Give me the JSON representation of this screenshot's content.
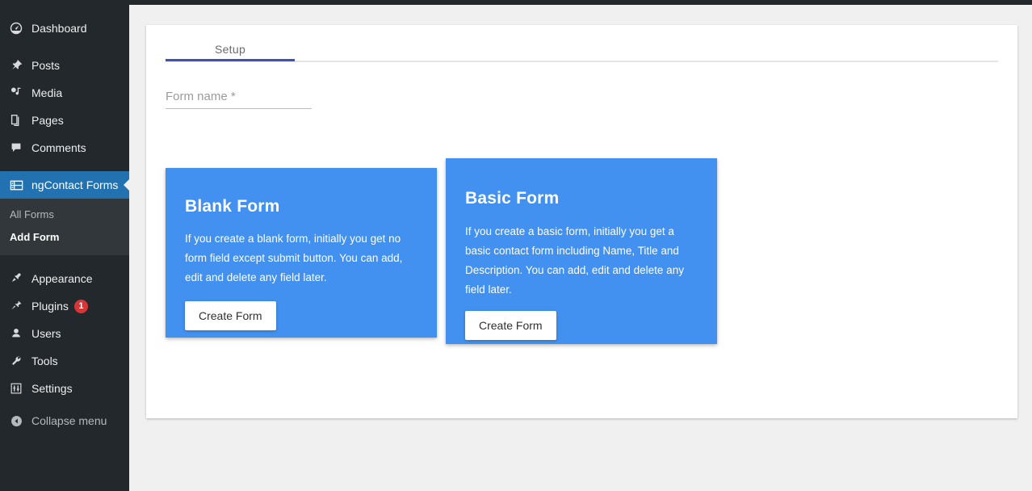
{
  "theme": {
    "sidebar_bg": "#23282d",
    "submenu_bg": "#32373c",
    "active_item_bg": "#2271b1",
    "card_blue": "#4290f0",
    "tab_accent": "#3f51b5",
    "badge_red": "#d63638",
    "page_bg": "#f0f0f1"
  },
  "sidebar": {
    "items": [
      {
        "label": "Dashboard",
        "icon": "dashboard-icon",
        "active": false
      },
      {
        "label": "Posts",
        "icon": "pin-icon",
        "active": false
      },
      {
        "label": "Media",
        "icon": "media-icon",
        "active": false
      },
      {
        "label": "Pages",
        "icon": "pages-icon",
        "active": false
      },
      {
        "label": "Comments",
        "icon": "comments-icon",
        "active": false
      },
      {
        "label": "ngContact Forms",
        "icon": "form-list-icon",
        "active": true
      },
      {
        "label": "Appearance",
        "icon": "paintbrush-icon",
        "active": false
      },
      {
        "label": "Plugins",
        "icon": "plug-icon",
        "active": false,
        "badge": "1"
      },
      {
        "label": "Users",
        "icon": "user-icon",
        "active": false
      },
      {
        "label": "Tools",
        "icon": "wrench-icon",
        "active": false
      },
      {
        "label": "Settings",
        "icon": "sliders-icon",
        "active": false
      },
      {
        "label": "Collapse menu",
        "icon": "collapse-arrow-icon",
        "active": false
      }
    ],
    "submenu": [
      {
        "label": "All Forms",
        "current": false
      },
      {
        "label": "Add Form",
        "current": true
      }
    ]
  },
  "main": {
    "tabs": [
      {
        "label": "Setup",
        "active": true
      }
    ],
    "form_name_field": {
      "placeholder": "Form name *",
      "value": ""
    },
    "cards": [
      {
        "title": "Blank Form",
        "description": "If you create a blank form, initially you get no form field except submit button. You can add, edit and delete any field later.",
        "button_label": "Create Form"
      },
      {
        "title": "Basic Form",
        "description": "If you create a basic form, initially you get a basic contact form including Name, Title and Description. You can add, edit and delete any field later.",
        "button_label": "Create Form"
      }
    ]
  }
}
